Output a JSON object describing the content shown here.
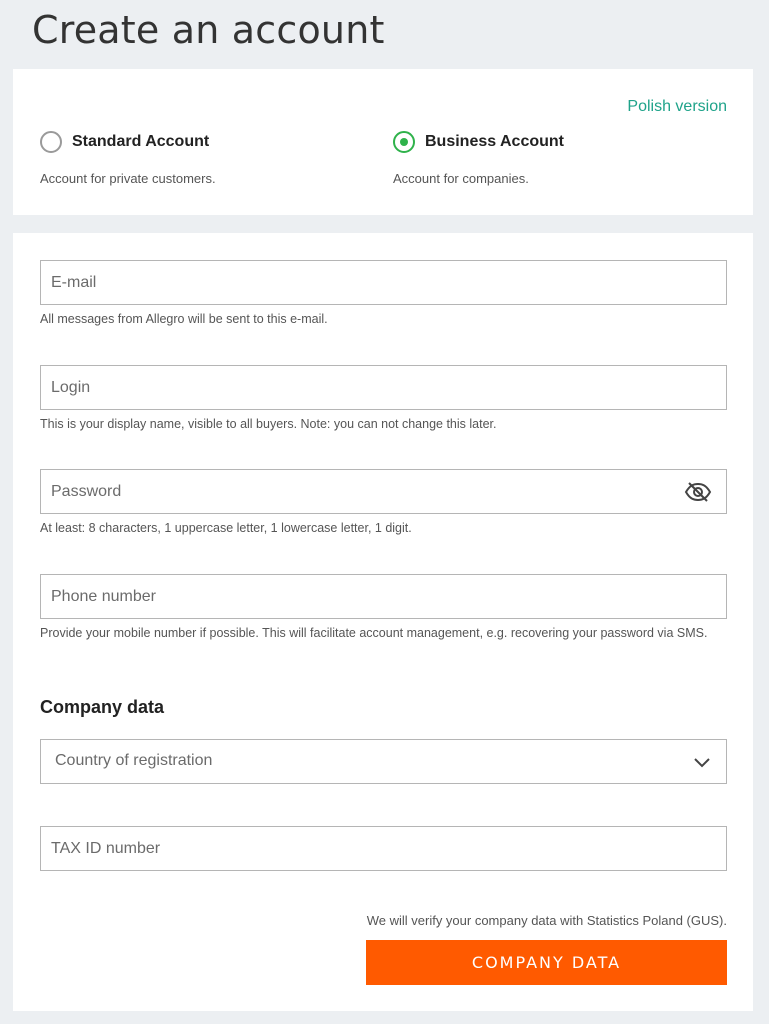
{
  "page": {
    "title": "Create an account"
  },
  "account_type": {
    "language_link": "Polish version",
    "options": [
      {
        "label": "Standard Account",
        "description": "Account for private customers.",
        "selected": false
      },
      {
        "label": "Business Account",
        "description": "Account for companies.",
        "selected": true
      }
    ]
  },
  "form": {
    "email": {
      "placeholder": "E-mail",
      "hint": "All messages from Allegro will be sent to this e-mail."
    },
    "login": {
      "placeholder": "Login",
      "hint": "This is your display name, visible to all buyers. Note: you can not change this later."
    },
    "password": {
      "placeholder": "Password",
      "hint": "At least: 8 characters, 1 uppercase letter, 1 lowercase letter, 1 digit.",
      "toggle_icon": "eye-off-icon"
    },
    "phone": {
      "placeholder": "Phone number",
      "hint": "Provide your mobile number if possible. This will facilitate account management, e.g. recovering your password via SMS."
    },
    "company_section_title": "Company data",
    "country": {
      "placeholder": "Country of registration",
      "icon": "chevron-down-icon"
    },
    "tax_id": {
      "placeholder": "TAX ID number"
    },
    "gus_note": "We will verify your company data with Statistics Poland (GUS).",
    "submit_label": "COMPANY DATA"
  },
  "colors": {
    "accent": "#ff5a00",
    "link": "#1fa38a",
    "radio_selected": "#2fb24b",
    "background": "#eceff2"
  }
}
